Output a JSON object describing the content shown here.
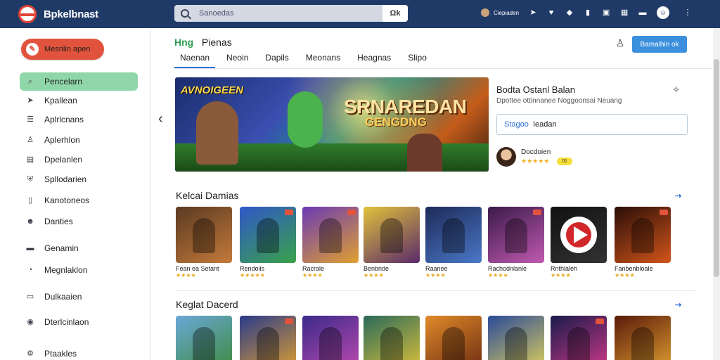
{
  "topbar": {
    "brand": "Bpkelbnast",
    "search_placeholder": "Sanoedas",
    "search_button": "Ωk",
    "user": "Ciepiaden",
    "icons": [
      "pin-icon",
      "heart-icon",
      "diamond-icon",
      "phone-icon",
      "grid-icon",
      "apps-icon",
      "window-icon",
      "profile-icon",
      "more-icon"
    ]
  },
  "sidebar": {
    "upload_label": "Mesnlin apen",
    "items": [
      {
        "label": "Pencelarn",
        "icon": "search-icon",
        "active": true
      },
      {
        "label": "Kpallean",
        "icon": "pin-icon"
      },
      {
        "label": "Aplrlcnans",
        "icon": "list-icon"
      },
      {
        "label": "Aplerhlon",
        "icon": "person-icon"
      },
      {
        "label": "Dpelanlen",
        "icon": "doc-icon"
      },
      {
        "label": "Spllodarien",
        "icon": "shield-icon"
      },
      {
        "label": "Kanotoneos",
        "icon": "phone-icon"
      },
      {
        "label": "Danties",
        "icon": "group-icon"
      },
      {
        "label": "Genamin",
        "icon": "folder-icon"
      },
      {
        "label": "Megnlaklon",
        "icon": "gauge-icon"
      },
      {
        "label": "Dulkaaien",
        "icon": "video-icon"
      },
      {
        "label": "Dterlcinlaon",
        "icon": "location-icon"
      },
      {
        "label": "Ptaakles",
        "icon": "settings-icon"
      }
    ]
  },
  "header": {
    "title_green": "Hng",
    "title_rest": "Pienas",
    "tabs": [
      "Naenan",
      "Neoin",
      "Dapils",
      "Meonans",
      "Heagnas",
      "Slipo"
    ],
    "action_button": "Bamaihin ok"
  },
  "featured": {
    "hero_tag": "AVNOIGEEN",
    "hero_title": "SRNAREDAN",
    "hero_subtitle": "GENGDNG",
    "title": "Bodta Ostanl Balan",
    "description": "Dpottee ottinnanee Noggoonsai Neuang",
    "input_bold": "Stagoo",
    "input_rest": "Ieadan",
    "developer": "Docdoien",
    "rating": "★★★★★",
    "badge": "01"
  },
  "sections": [
    {
      "title": "Kelcai Damias",
      "more": "⇢",
      "games": [
        {
          "name": "Fean ea Setant",
          "stars": "★★★★",
          "palette": [
            "#5a3a22",
            "#c47a3a"
          ],
          "type": "figure",
          "badge": false
        },
        {
          "name": "Rendoiis",
          "stars": "★★★★★",
          "palette": [
            "#2f57c8",
            "#3aa24a"
          ],
          "type": "figure",
          "badge": true
        },
        {
          "name": "Racrale",
          "stars": "★★★★",
          "palette": [
            "#6a3ab5",
            "#e0a030"
          ],
          "type": "figure",
          "badge": true
        },
        {
          "name": "Benbnde",
          "stars": "★★★★",
          "palette": [
            "#e0c23a",
            "#5a2a6a"
          ],
          "type": "figure",
          "badge": false
        },
        {
          "name": "Raanee",
          "stars": "★★★★",
          "palette": [
            "#1d2a58",
            "#4a78c8"
          ],
          "type": "figure",
          "badge": false
        },
        {
          "name": "Rachodnlanle",
          "stars": "★★★★",
          "palette": [
            "#3a1a4a",
            "#c05ab0"
          ],
          "type": "figure",
          "badge": true
        },
        {
          "name": "Rnthlaleh",
          "stars": "★★★★",
          "palette": [
            "#111111",
            "#333333"
          ],
          "type": "play",
          "badge": false
        },
        {
          "name": "Fanbenbloale",
          "stars": "★★★★",
          "palette": [
            "#2a0e08",
            "#d2551a"
          ],
          "type": "figure",
          "badge": true
        }
      ]
    },
    {
      "title": "Keglat Dacerd",
      "more": "⇢",
      "games": [
        {
          "palette": [
            "#6aa8d8",
            "#3c8a3a"
          ],
          "type": "figure",
          "badge": false
        },
        {
          "palette": [
            "#2a3a8a",
            "#e0a030"
          ],
          "type": "figure",
          "badge": true
        },
        {
          "palette": [
            "#3a2a8a",
            "#c04ab0"
          ],
          "type": "figure",
          "badge": false
        },
        {
          "palette": [
            "#2a6a5a",
            "#e0c23a"
          ],
          "type": "figure",
          "badge": false
        },
        {
          "palette": [
            "#e08a2a",
            "#6a2a10"
          ],
          "type": "figure",
          "badge": false
        },
        {
          "palette": [
            "#2a4a9a",
            "#e0d05a"
          ],
          "type": "figure",
          "badge": false
        },
        {
          "palette": [
            "#1a1a4a",
            "#d03a8a"
          ],
          "type": "figure",
          "badge": true
        },
        {
          "palette": [
            "#5a1a0a",
            "#e0a030"
          ],
          "type": "figure",
          "badge": false
        }
      ]
    }
  ]
}
